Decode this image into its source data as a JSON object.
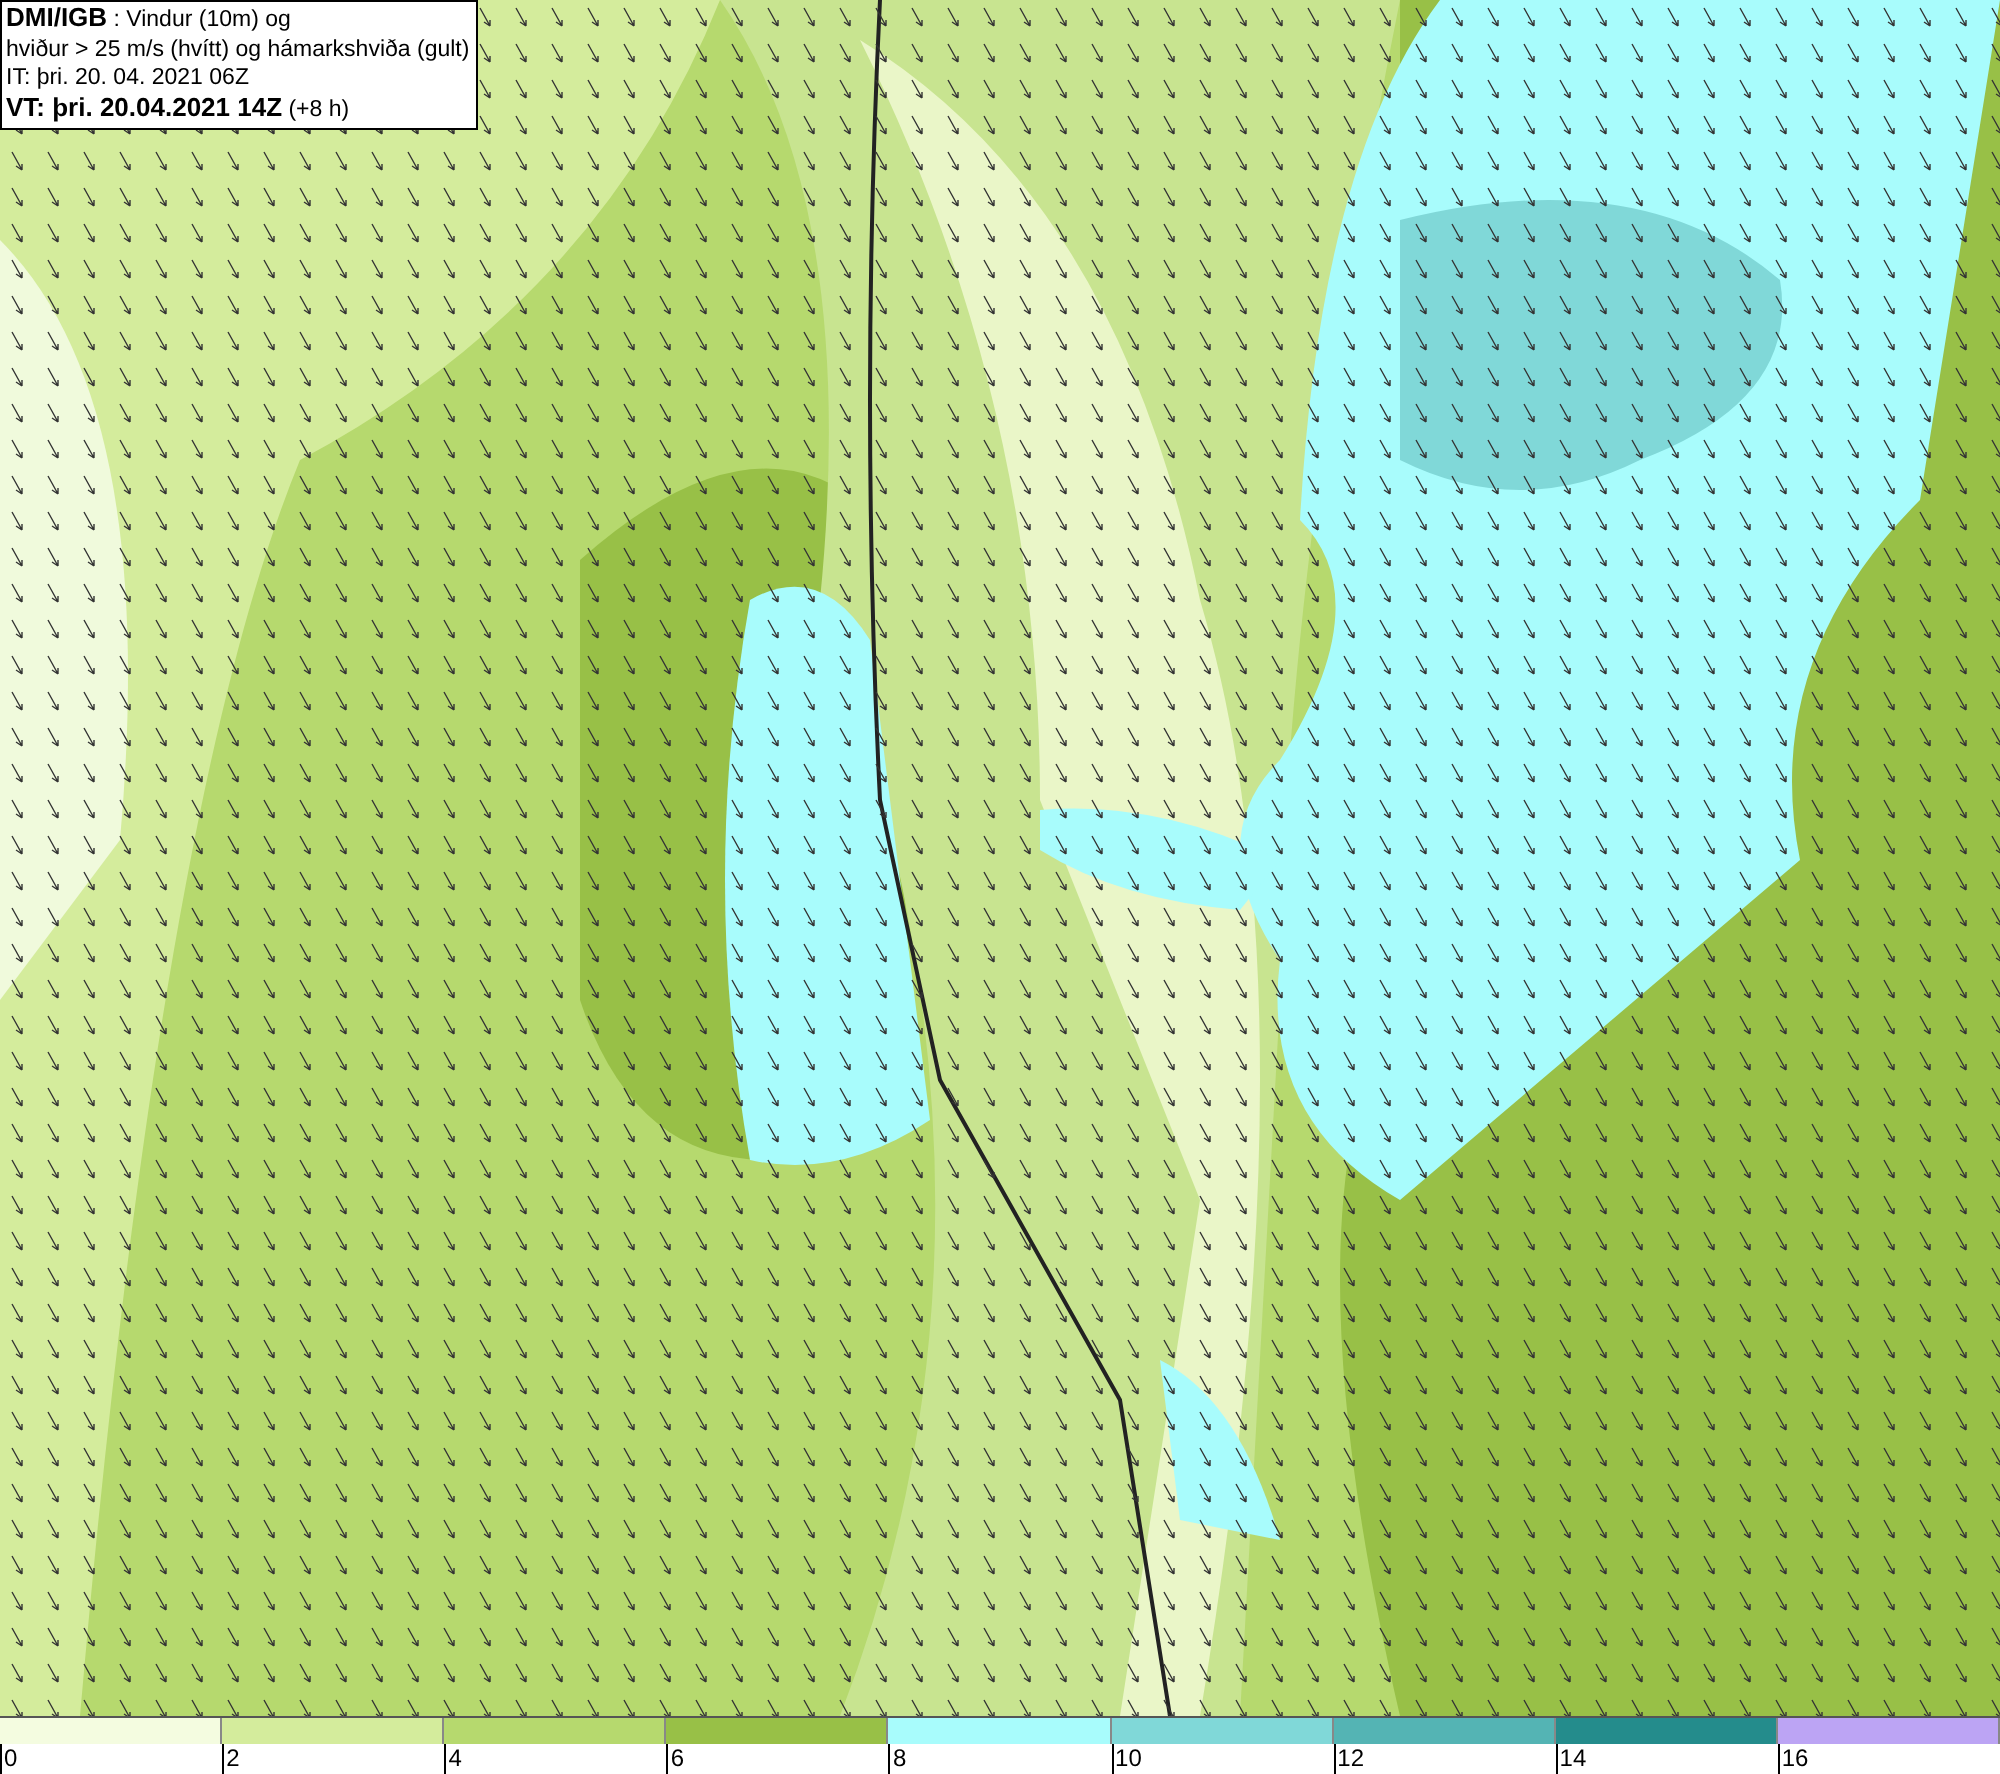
{
  "info_box": {
    "lines": [
      "**DMI/IGB** : Vindur (10m) og",
      "hviður > 25 m/s (hvítt) og hámarkshviða (gult)",
      "IT: þri. 20. 04. 2021 06Z",
      "**VT: þri. 20.04.2021 14Z** (+8 h)"
    ]
  },
  "legend": {
    "bins": [
      {
        "color": "#f4fce0"
      },
      {
        "color": "#d4ec9c"
      },
      {
        "color": "#b6d96e"
      },
      {
        "color": "#98c047"
      },
      {
        "color": "#a8fcfc"
      },
      {
        "color": "#80d8d8"
      },
      {
        "color": "#54b4b4"
      },
      {
        "color": "#248c8c"
      },
      {
        "color": "#bca4f4"
      }
    ],
    "ticks": [
      "0",
      "2",
      "4",
      "6",
      "8",
      "10",
      "12",
      "14",
      "16"
    ]
  }
}
